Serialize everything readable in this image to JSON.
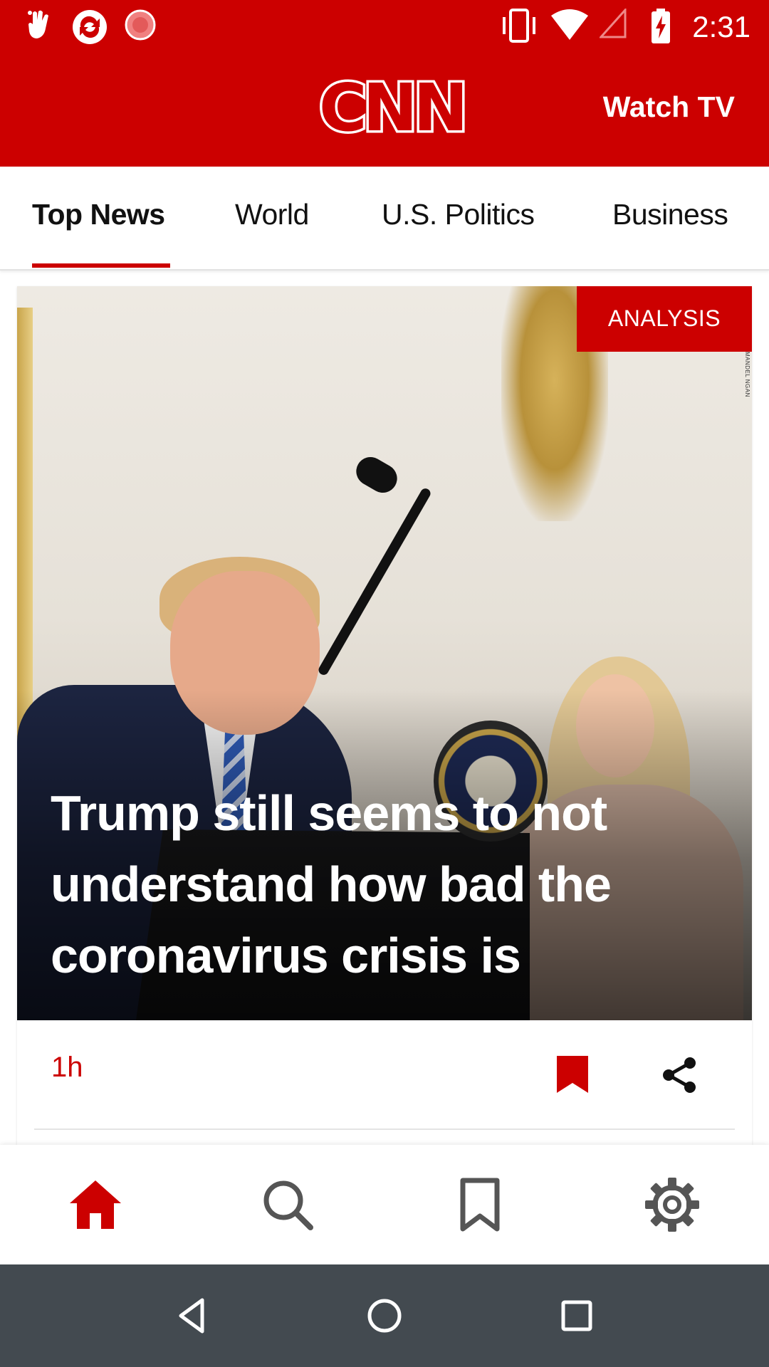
{
  "status_bar": {
    "time": "2:31",
    "icons": [
      "hand-gesture-icon",
      "sync-app-icon",
      "record-icon",
      "vibrate-icon",
      "wifi-icon",
      "cell-signal-icon",
      "battery-charging-icon"
    ]
  },
  "header": {
    "logo_text": "CNN",
    "watch_tv_label": "Watch TV"
  },
  "tabs": [
    {
      "label": "Top News",
      "active": true
    },
    {
      "label": "World",
      "active": false
    },
    {
      "label": "U.S. Politics",
      "active": false
    },
    {
      "label": "Business",
      "active": false
    }
  ],
  "card": {
    "tag": "ANALYSIS",
    "photo_credit": "MANDEL NGAN",
    "headline": "Trump still seems to not understand how bad the coronavirus crisis is",
    "timestamp": "1h"
  },
  "bottom_nav": [
    {
      "icon": "home-icon",
      "active": true
    },
    {
      "icon": "search-icon",
      "active": false
    },
    {
      "icon": "bookmark-icon",
      "active": false
    },
    {
      "icon": "gear-icon",
      "active": false
    }
  ],
  "system_nav": [
    "back-icon",
    "home-circle-icon",
    "recents-icon"
  ],
  "colors": {
    "brand_red": "#cc0000",
    "tag_red": "#cc0000",
    "icon_gray": "#555555",
    "system_nav_bg": "#434a50"
  }
}
